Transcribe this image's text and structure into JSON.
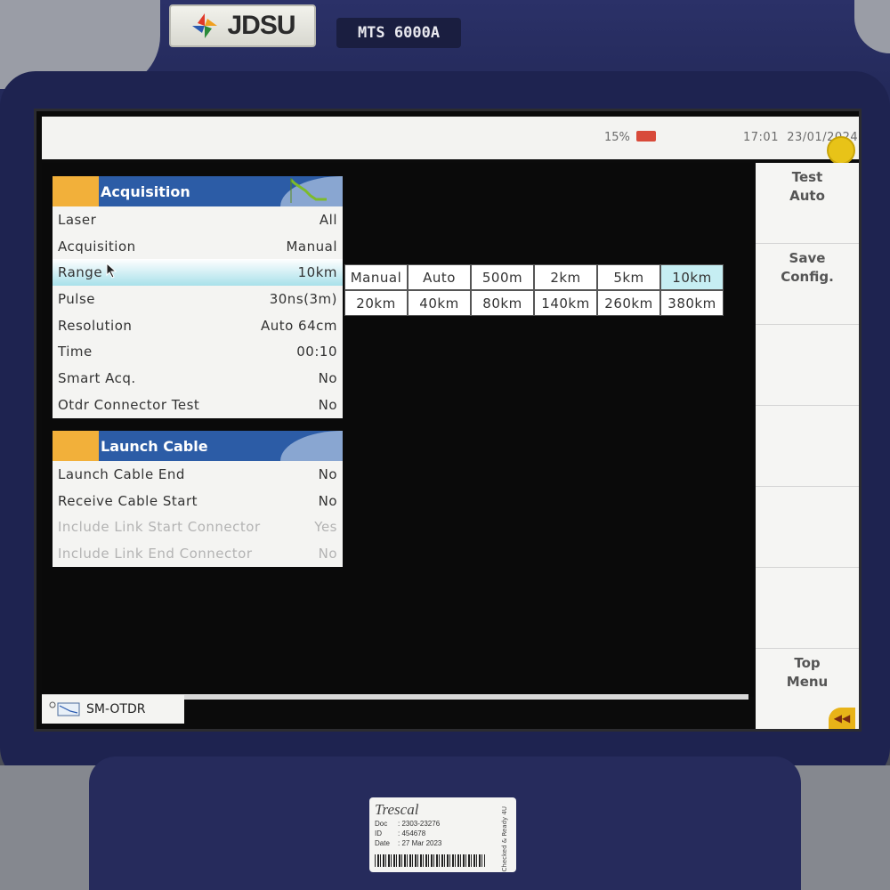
{
  "device": {
    "brand": "JDSU",
    "model": "MTS 6000A"
  },
  "status_bar": {
    "battery": "15%",
    "time": "17:01",
    "date": "23/01/2024"
  },
  "acquisition_panel": {
    "title": "Acquisition",
    "rows": [
      {
        "label": "Laser",
        "value": "All"
      },
      {
        "label": "Acquisition",
        "value": "Manual"
      },
      {
        "label": "Range",
        "value": "10km"
      },
      {
        "label": "Pulse",
        "value": "30ns(3m)"
      },
      {
        "label": "Resolution",
        "value": "Auto 64cm"
      },
      {
        "label": "Time",
        "value": "00:10"
      },
      {
        "label": "Smart Acq.",
        "value": "No"
      },
      {
        "label": "Otdr Connector Test",
        "value": "No"
      }
    ]
  },
  "launch_cable_panel": {
    "title": "Launch Cable",
    "rows": [
      {
        "label": "Launch Cable End",
        "value": "No"
      },
      {
        "label": "Receive Cable Start",
        "value": "No"
      },
      {
        "label": "Include Link Start Connector",
        "value": "Yes"
      },
      {
        "label": "Include Link End Connector",
        "value": "No"
      }
    ]
  },
  "range_options": [
    "Manual",
    "Auto",
    "500m",
    "2km",
    "5km",
    "10km",
    "20km",
    "40km",
    "80km",
    "140km",
    "260km",
    "380km"
  ],
  "range_selected": "10km",
  "softkeys": {
    "test_auto": "Test\nAuto",
    "save_config": "Save\nConfig.",
    "top_menu": "Top\nMenu"
  },
  "bottom_tab": {
    "label": "SM-OTDR"
  },
  "sticker": {
    "brand": "Trescal",
    "doc_label": "Doc",
    "doc_value": ": 2303-23276",
    "id_label": "ID",
    "id_value": ": 454678",
    "date_label": "Date",
    "date_value": ": 27 Mar 2023",
    "side_text": "Checked & Ready 4U"
  },
  "colors": {
    "panel_header_blue": "#2c5ca6",
    "panel_header_orange": "#f2b03a",
    "selected_row": "#a8e1ea",
    "device_body": "#1e2350"
  }
}
